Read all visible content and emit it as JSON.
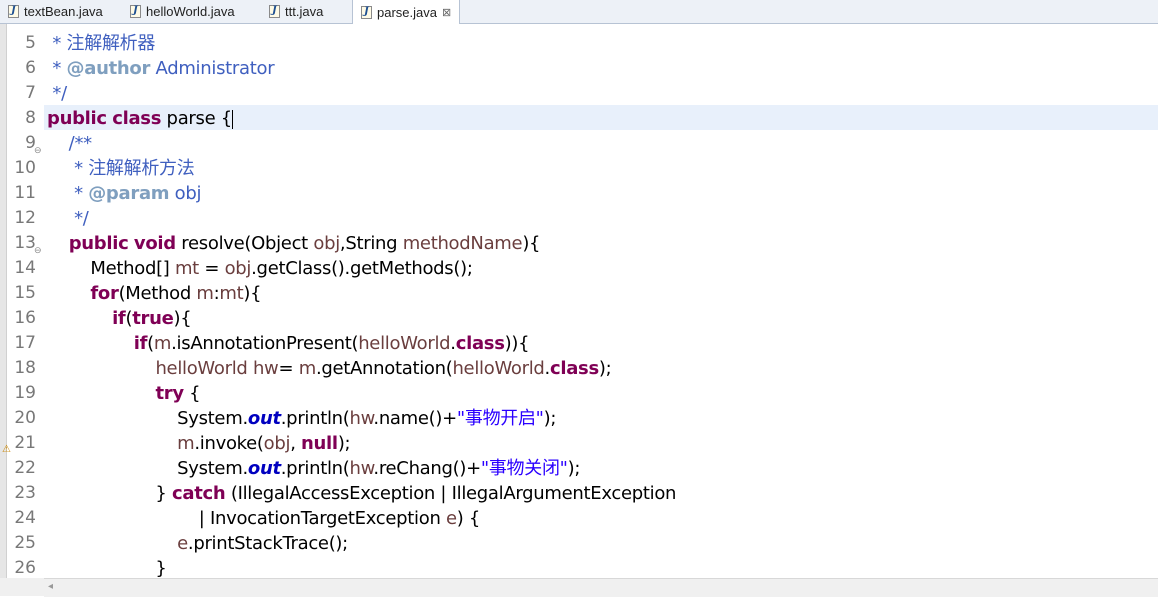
{
  "tabs": [
    {
      "label": "textBean.java",
      "active": false
    },
    {
      "label": "helloWorld.java",
      "active": false
    },
    {
      "label": "ttt.java",
      "active": false
    },
    {
      "label": "parse.java",
      "active": true,
      "close": "⊠"
    }
  ],
  "file_icon_glyph": "J",
  "lines": [
    {
      "n": "5",
      "segs": [
        {
          "c": "cm",
          "t": " * 注解解析器"
        }
      ]
    },
    {
      "n": "6",
      "segs": [
        {
          "c": "cm",
          "t": " * "
        },
        {
          "c": "cmtag",
          "t": "@author"
        },
        {
          "c": "cm",
          "t": " Administrator"
        }
      ]
    },
    {
      "n": "7",
      "segs": [
        {
          "c": "cm",
          "t": " */"
        }
      ]
    },
    {
      "n": "8",
      "segs": [
        {
          "c": "kw",
          "t": "public"
        },
        {
          "c": "",
          "t": " "
        },
        {
          "c": "kw",
          "t": "class"
        },
        {
          "c": "",
          "t": " parse {"
        }
      ],
      "caret": true
    },
    {
      "n": "9",
      "fold": true,
      "segs": [
        {
          "c": "cm",
          "t": "    /**"
        }
      ]
    },
    {
      "n": "10",
      "segs": [
        {
          "c": "cm",
          "t": "     * 注解解析方法"
        }
      ]
    },
    {
      "n": "11",
      "segs": [
        {
          "c": "cm",
          "t": "     * "
        },
        {
          "c": "cmtag",
          "t": "@param"
        },
        {
          "c": "cm",
          "t": " obj"
        }
      ]
    },
    {
      "n": "12",
      "segs": [
        {
          "c": "cm",
          "t": "     */"
        }
      ]
    },
    {
      "n": "13",
      "fold": true,
      "segs": [
        {
          "c": "",
          "t": "    "
        },
        {
          "c": "kw",
          "t": "public"
        },
        {
          "c": "",
          "t": " "
        },
        {
          "c": "kw",
          "t": "void"
        },
        {
          "c": "",
          "t": " resolve(Object "
        },
        {
          "c": "var",
          "t": "obj"
        },
        {
          "c": "",
          "t": ",String "
        },
        {
          "c": "var",
          "t": "methodName"
        },
        {
          "c": "",
          "t": "){"
        }
      ]
    },
    {
      "n": "14",
      "segs": [
        {
          "c": "",
          "t": "        Method[] "
        },
        {
          "c": "var",
          "t": "mt"
        },
        {
          "c": "",
          "t": " = "
        },
        {
          "c": "var",
          "t": "obj"
        },
        {
          "c": "",
          "t": ".getClass().getMethods();"
        }
      ]
    },
    {
      "n": "15",
      "segs": [
        {
          "c": "",
          "t": "        "
        },
        {
          "c": "kw",
          "t": "for"
        },
        {
          "c": "",
          "t": "(Method "
        },
        {
          "c": "var",
          "t": "m"
        },
        {
          "c": "",
          "t": ":"
        },
        {
          "c": "var",
          "t": "mt"
        },
        {
          "c": "",
          "t": "){"
        }
      ]
    },
    {
      "n": "16",
      "segs": [
        {
          "c": "",
          "t": "            "
        },
        {
          "c": "kw",
          "t": "if"
        },
        {
          "c": "",
          "t": "("
        },
        {
          "c": "kw",
          "t": "true"
        },
        {
          "c": "",
          "t": "){"
        }
      ]
    },
    {
      "n": "17",
      "segs": [
        {
          "c": "",
          "t": "                "
        },
        {
          "c": "kw",
          "t": "if"
        },
        {
          "c": "",
          "t": "("
        },
        {
          "c": "var",
          "t": "m"
        },
        {
          "c": "",
          "t": ".isAnnotationPresent("
        },
        {
          "c": "var",
          "t": "helloWorld"
        },
        {
          "c": "",
          "t": "."
        },
        {
          "c": "kw",
          "t": "class"
        },
        {
          "c": "",
          "t": ")){"
        }
      ]
    },
    {
      "n": "18",
      "segs": [
        {
          "c": "",
          "t": "                    "
        },
        {
          "c": "var",
          "t": "helloWorld"
        },
        {
          "c": "",
          "t": " "
        },
        {
          "c": "var",
          "t": "hw"
        },
        {
          "c": "",
          "t": "= "
        },
        {
          "c": "var",
          "t": "m"
        },
        {
          "c": "",
          "t": ".getAnnotation("
        },
        {
          "c": "var",
          "t": "helloWorld"
        },
        {
          "c": "",
          "t": "."
        },
        {
          "c": "kw",
          "t": "class"
        },
        {
          "c": "",
          "t": ");"
        }
      ]
    },
    {
      "n": "19",
      "segs": [
        {
          "c": "",
          "t": "                    "
        },
        {
          "c": "kw",
          "t": "try"
        },
        {
          "c": "",
          "t": " {"
        }
      ]
    },
    {
      "n": "20",
      "segs": [
        {
          "c": "",
          "t": "                        System."
        },
        {
          "c": "field",
          "t": "out"
        },
        {
          "c": "",
          "t": ".println("
        },
        {
          "c": "var",
          "t": "hw"
        },
        {
          "c": "",
          "t": ".name()+"
        },
        {
          "c": "str",
          "t": "\"事物开启\""
        },
        {
          "c": "",
          "t": ");"
        }
      ]
    },
    {
      "n": "21",
      "warn": true,
      "segs": [
        {
          "c": "",
          "t": "                        "
        },
        {
          "c": "var",
          "t": "m"
        },
        {
          "c": "",
          "t": ".invoke("
        },
        {
          "c": "var",
          "t": "obj"
        },
        {
          "c": "",
          "t": ", "
        },
        {
          "c": "kw",
          "t": "null"
        },
        {
          "c": "",
          "t": ");"
        }
      ]
    },
    {
      "n": "22",
      "segs": [
        {
          "c": "",
          "t": "                        System."
        },
        {
          "c": "field",
          "t": "out"
        },
        {
          "c": "",
          "t": ".println("
        },
        {
          "c": "var",
          "t": "hw"
        },
        {
          "c": "",
          "t": ".reChang()+"
        },
        {
          "c": "str",
          "t": "\"事物关闭\""
        },
        {
          "c": "",
          "t": ");"
        }
      ]
    },
    {
      "n": "23",
      "segs": [
        {
          "c": "",
          "t": "                    } "
        },
        {
          "c": "kw",
          "t": "catch"
        },
        {
          "c": "",
          "t": " (IllegalAccessException | IllegalArgumentException"
        }
      ]
    },
    {
      "n": "24",
      "segs": [
        {
          "c": "",
          "t": "                            | InvocationTargetException "
        },
        {
          "c": "var",
          "t": "e"
        },
        {
          "c": "",
          "t": ") {"
        }
      ]
    },
    {
      "n": "25",
      "segs": [
        {
          "c": "",
          "t": "                        "
        },
        {
          "c": "var",
          "t": "e"
        },
        {
          "c": "",
          "t": ".printStackTrace();"
        }
      ]
    },
    {
      "n": "26",
      "segs": [
        {
          "c": "",
          "t": "                    }"
        }
      ]
    }
  ]
}
